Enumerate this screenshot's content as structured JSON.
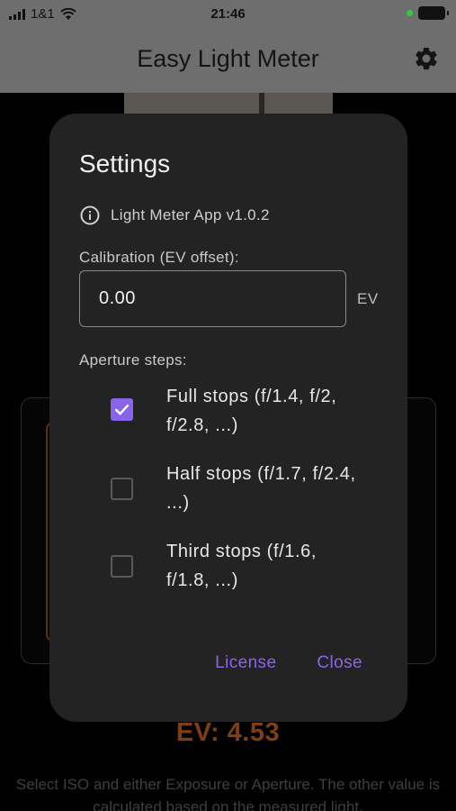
{
  "status_bar": {
    "carrier": "1&1",
    "time": "21:46"
  },
  "app_bar": {
    "title": "Easy Light Meter",
    "settings_icon": "gear-icon"
  },
  "background": {
    "ev_readout": "EV: 4.53",
    "help_text": "Select ISO and either Exposure or Aperture. The other value is calculated based on the measured light."
  },
  "dialog": {
    "title": "Settings",
    "info_icon": "info-icon",
    "version_text": "Light Meter App v1.0.2",
    "calibration_label": "Calibration (EV offset):",
    "calibration_value": "0.00",
    "calibration_unit": "EV",
    "aperture_label": "Aperture steps:",
    "options": [
      {
        "label": "Full stops (f/1.4, f/2, f/2.8, ...)",
        "checked": true
      },
      {
        "label": "Half stops (f/1.7, f/2.4, ...)",
        "checked": false
      },
      {
        "label": "Third stops (f/1.6, f/1.8, ...)",
        "checked": false
      }
    ],
    "license_label": "License",
    "close_label": "Close"
  },
  "colors": {
    "accent": "#8a64e8",
    "dialog_bg": "#232323",
    "appbar_dimmed": "#6e6e6e",
    "ev_orange_dimmed": "#7d3e14"
  }
}
